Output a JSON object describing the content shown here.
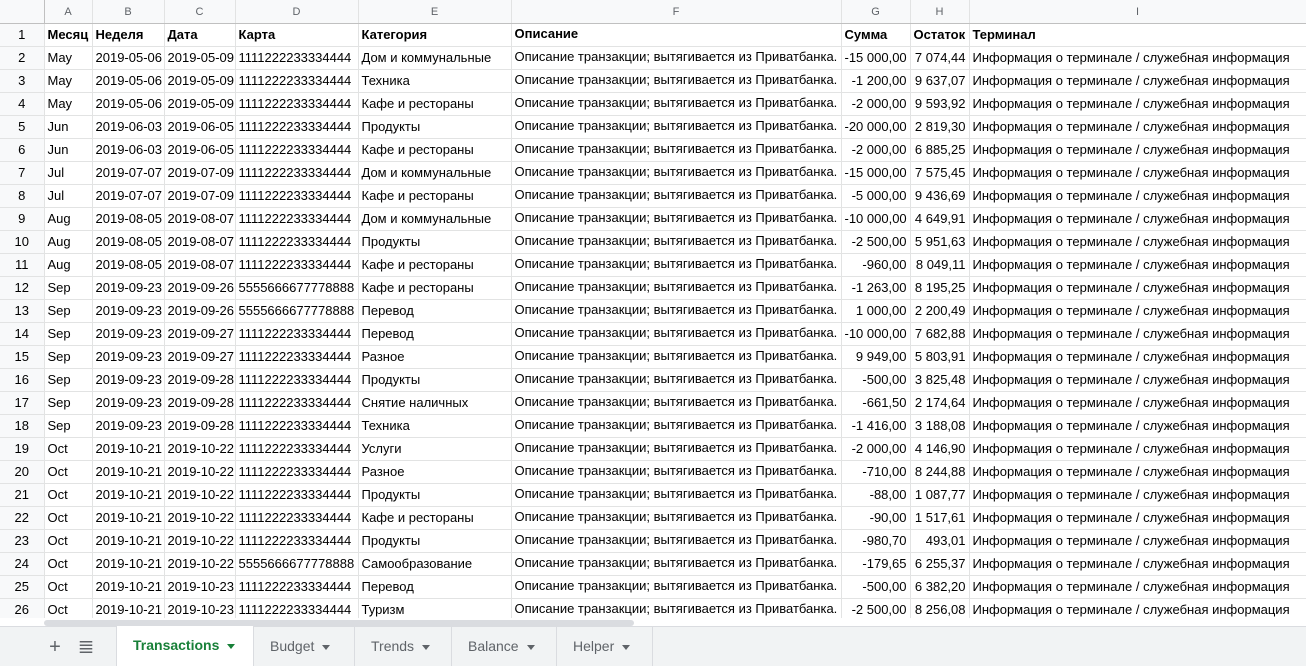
{
  "columns": [
    "A",
    "B",
    "C",
    "D",
    "E",
    "F",
    "G",
    "H",
    "I"
  ],
  "row_numbers": [
    "1",
    "2",
    "3",
    "4",
    "5",
    "6",
    "7",
    "8",
    "9",
    "10",
    "11",
    "12",
    "13",
    "14",
    "15",
    "16",
    "17",
    "18",
    "19",
    "20",
    "21",
    "22",
    "23",
    "24",
    "25",
    "26"
  ],
  "rows": [
    [
      "Месяц",
      "Неделя",
      "Дата",
      "Карта",
      "Категория",
      "Описание",
      "Сумма",
      "Остаток",
      "Терминал"
    ],
    [
      "May",
      "2019-05-06",
      "2019-05-09",
      "1111222233334444",
      "Дом и коммунальные",
      "Описание транзакции; вытягивается из Приватбанка.",
      "-15 000,00",
      "7 074,44",
      "Информация о терминале / служебная информация"
    ],
    [
      "May",
      "2019-05-06",
      "2019-05-09",
      "1111222233334444",
      "Техника",
      "Описание транзакции; вытягивается из Приватбанка.",
      "-1 200,00",
      "9 637,07",
      "Информация о терминале / служебная информация"
    ],
    [
      "May",
      "2019-05-06",
      "2019-05-09",
      "1111222233334444",
      "Кафе и рестораны",
      "Описание транзакции; вытягивается из Приватбанка.",
      "-2 000,00",
      "9 593,92",
      "Информация о терминале / служебная информация"
    ],
    [
      "Jun",
      "2019-06-03",
      "2019-06-05",
      "1111222233334444",
      "Продукты",
      "Описание транзакции; вытягивается из Приватбанка.",
      "-20 000,00",
      "2 819,30",
      "Информация о терминале / служебная информация"
    ],
    [
      "Jun",
      "2019-06-03",
      "2019-06-05",
      "1111222233334444",
      "Кафе и рестораны",
      "Описание транзакции; вытягивается из Приватбанка.",
      "-2 000,00",
      "6 885,25",
      "Информация о терминале / служебная информация"
    ],
    [
      "Jul",
      "2019-07-07",
      "2019-07-09",
      "1111222233334444",
      "Дом и коммунальные",
      "Описание транзакции; вытягивается из Приватбанка.",
      "-15 000,00",
      "7 575,45",
      "Информация о терминале / служебная информация"
    ],
    [
      "Jul",
      "2019-07-07",
      "2019-07-09",
      "1111222233334444",
      "Кафе и рестораны",
      "Описание транзакции; вытягивается из Приватбанка.",
      "-5 000,00",
      "9 436,69",
      "Информация о терминале / служебная информация"
    ],
    [
      "Aug",
      "2019-08-05",
      "2019-08-07",
      "1111222233334444",
      "Дом и коммунальные",
      "Описание транзакции; вытягивается из Приватбанка.",
      "-10 000,00",
      "4 649,91",
      "Информация о терминале / служебная информация"
    ],
    [
      "Aug",
      "2019-08-05",
      "2019-08-07",
      "1111222233334444",
      "Продукты",
      "Описание транзакции; вытягивается из Приватбанка.",
      "-2 500,00",
      "5 951,63",
      "Информация о терминале / служебная информация"
    ],
    [
      "Aug",
      "2019-08-05",
      "2019-08-07",
      "1111222233334444",
      "Кафе и рестораны",
      "Описание транзакции; вытягивается из Приватбанка.",
      "-960,00",
      "8 049,11",
      "Информация о терминале / служебная информация"
    ],
    [
      "Sep",
      "2019-09-23",
      "2019-09-26",
      "5555666677778888",
      "Кафе и рестораны",
      "Описание транзакции; вытягивается из Приватбанка.",
      "-1 263,00",
      "8 195,25",
      "Информация о терминале / служебная информация"
    ],
    [
      "Sep",
      "2019-09-23",
      "2019-09-26",
      "5555666677778888",
      "Перевод",
      "Описание транзакции; вытягивается из Приватбанка.",
      "1 000,00",
      "2 200,49",
      "Информация о терминале / служебная информация"
    ],
    [
      "Sep",
      "2019-09-23",
      "2019-09-27",
      "1111222233334444",
      "Перевод",
      "Описание транзакции; вытягивается из Приватбанка.",
      "-10 000,00",
      "7 682,88",
      "Информация о терминале / служебная информация"
    ],
    [
      "Sep",
      "2019-09-23",
      "2019-09-27",
      "1111222233334444",
      "Разное",
      "Описание транзакции; вытягивается из Приватбанка.",
      "9 949,00",
      "5 803,91",
      "Информация о терминале / служебная информация"
    ],
    [
      "Sep",
      "2019-09-23",
      "2019-09-28",
      "1111222233334444",
      "Продукты",
      "Описание транзакции; вытягивается из Приватбанка.",
      "-500,00",
      "3 825,48",
      "Информация о терминале / служебная информация"
    ],
    [
      "Sep",
      "2019-09-23",
      "2019-09-28",
      "1111222233334444",
      "Снятие наличных",
      "Описание транзакции; вытягивается из Приватбанка.",
      "-661,50",
      "2 174,64",
      "Информация о терминале / служебная информация"
    ],
    [
      "Sep",
      "2019-09-23",
      "2019-09-28",
      "1111222233334444",
      "Техника",
      "Описание транзакции; вытягивается из Приватбанка.",
      "-1 416,00",
      "3 188,08",
      "Информация о терминале / служебная информация"
    ],
    [
      "Oct",
      "2019-10-21",
      "2019-10-22",
      "1111222233334444",
      "Услуги",
      "Описание транзакции; вытягивается из Приватбанка.",
      "-2 000,00",
      "4 146,90",
      "Информация о терминале / служебная информация"
    ],
    [
      "Oct",
      "2019-10-21",
      "2019-10-22",
      "1111222233334444",
      "Разное",
      "Описание транзакции; вытягивается из Приватбанка.",
      "-710,00",
      "8 244,88",
      "Информация о терминале / служебная информация"
    ],
    [
      "Oct",
      "2019-10-21",
      "2019-10-22",
      "1111222233334444",
      "Продукты",
      "Описание транзакции; вытягивается из Приватбанка.",
      "-88,00",
      "1 087,77",
      "Информация о терминале / служебная информация"
    ],
    [
      "Oct",
      "2019-10-21",
      "2019-10-22",
      "1111222233334444",
      "Кафе и рестораны",
      "Описание транзакции; вытягивается из Приватбанка.",
      "-90,00",
      "1 517,61",
      "Информация о терминале / служебная информация"
    ],
    [
      "Oct",
      "2019-10-21",
      "2019-10-22",
      "1111222233334444",
      "Продукты",
      "Описание транзакции; вытягивается из Приватбанка.",
      "-980,70",
      "493,01",
      "Информация о терминале / служебная информация"
    ],
    [
      "Oct",
      "2019-10-21",
      "2019-10-22",
      "5555666677778888",
      "Самообразование",
      "Описание транзакции; вытягивается из Приватбанка.",
      "-179,65",
      "6 255,37",
      "Информация о терминале / служебная информация"
    ],
    [
      "Oct",
      "2019-10-21",
      "2019-10-23",
      "1111222233334444",
      "Перевод",
      "Описание транзакции; вытягивается из Приватбанка.",
      "-500,00",
      "6 382,20",
      "Информация о терминале / служебная информация"
    ],
    [
      "Oct",
      "2019-10-21",
      "2019-10-23",
      "1111222233334444",
      "Туризм",
      "Описание транзакции; вытягивается из Приватбанка.",
      "-2 500,00",
      "8 256,08",
      "Информация о терминале / служебная информация"
    ]
  ],
  "tabs": [
    {
      "label": "Transactions",
      "active": true
    },
    {
      "label": "Budget",
      "active": false
    },
    {
      "label": "Trends",
      "active": false
    },
    {
      "label": "Balance",
      "active": false
    },
    {
      "label": "Helper",
      "active": false
    }
  ],
  "icons": {
    "add_sheet": "plus-icon",
    "all_sheets": "list-icon"
  },
  "colors": {
    "active_tab": "#188038",
    "header_bg": "#f8f9fa",
    "grid_line": "#e2e3e3"
  }
}
